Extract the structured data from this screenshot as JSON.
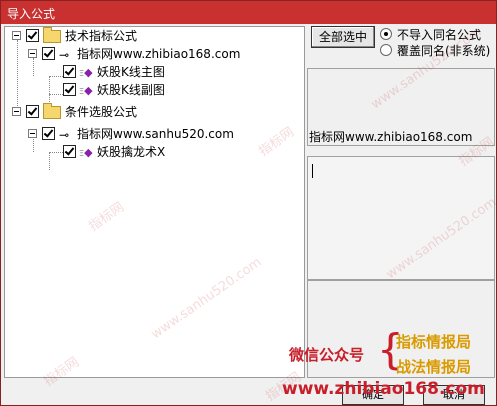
{
  "window": {
    "title": "导入公式"
  },
  "tree": {
    "groups": [
      {
        "label": "技术指标公式",
        "source": "指标网www.zhibiao168.com",
        "items": [
          "妖股K线主图",
          "妖股K线副图"
        ]
      },
      {
        "label": "条件选股公式",
        "source": "指标网www.sanhu520.com",
        "items": [
          "妖股擒龙术X"
        ]
      }
    ]
  },
  "right": {
    "select_all_label": "全部选中",
    "radio_no_import": "不导入同名公式",
    "radio_overwrite": "覆盖同名(非系统)",
    "info_name": "指标网www.zhibiao168.com"
  },
  "watermarks": [
    "www.sanhu520.com",
    "指标网",
    "www.sanhu520.com",
    "指标网",
    "指标网",
    "www.sanhu520.com",
    "指标网",
    "指标网"
  ],
  "promo": {
    "wechat": "微信公众号",
    "brace": "{",
    "line1": "指标情报局",
    "line2": "战法情报局",
    "site": "www.zhibiao168.com"
  },
  "footer": {
    "ok_label": "确定",
    "cancel_label": "取消"
  },
  "colors": {
    "titlebar": "#c8312f",
    "promo_red": "#c81e2a",
    "promo_gold": "#d99b00"
  }
}
